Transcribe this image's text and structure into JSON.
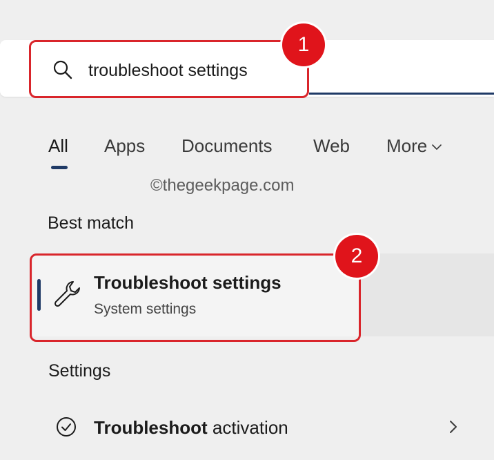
{
  "search": {
    "query": "troubleshoot settings"
  },
  "tabs": [
    {
      "label": "All"
    },
    {
      "label": "Apps"
    },
    {
      "label": "Documents"
    },
    {
      "label": "Web"
    },
    {
      "label": "More"
    }
  ],
  "watermark": "©thegeekpage.com",
  "best_match": {
    "heading": "Best match",
    "title": "Troubleshoot settings",
    "subtitle": "System settings",
    "icon": "wrench-icon"
  },
  "settings_section": {
    "heading": "Settings",
    "items": [
      {
        "title_bold": "Troubleshoot",
        "title_rest": " activation",
        "icon": "check-circle-icon"
      }
    ]
  },
  "callouts": [
    {
      "number": "1"
    },
    {
      "number": "2"
    }
  ],
  "colors": {
    "accent": "#1f3a66",
    "callout": "#e0141b",
    "background": "#efefef"
  }
}
